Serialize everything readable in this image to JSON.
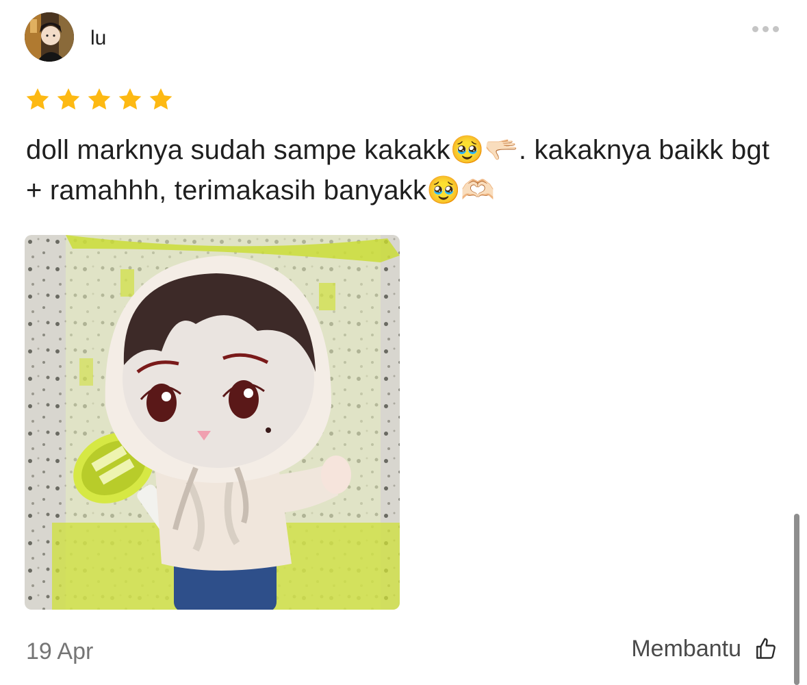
{
  "review": {
    "username": "lu",
    "rating": 5,
    "text": "doll marknya sudah sampe kakakk🥹🫳🏻. kakaknya baikk bgt + ramahhh, terimakasih banyakk🥹🫶🏻",
    "date": "19 Apr",
    "helpful_label": "Membantu",
    "avatar_icon": "user-avatar-photo",
    "photo_icon": "review-photo-doll"
  },
  "colors": {
    "star": "#FDB913",
    "text": "#1f1f1f",
    "muted": "#757575"
  }
}
